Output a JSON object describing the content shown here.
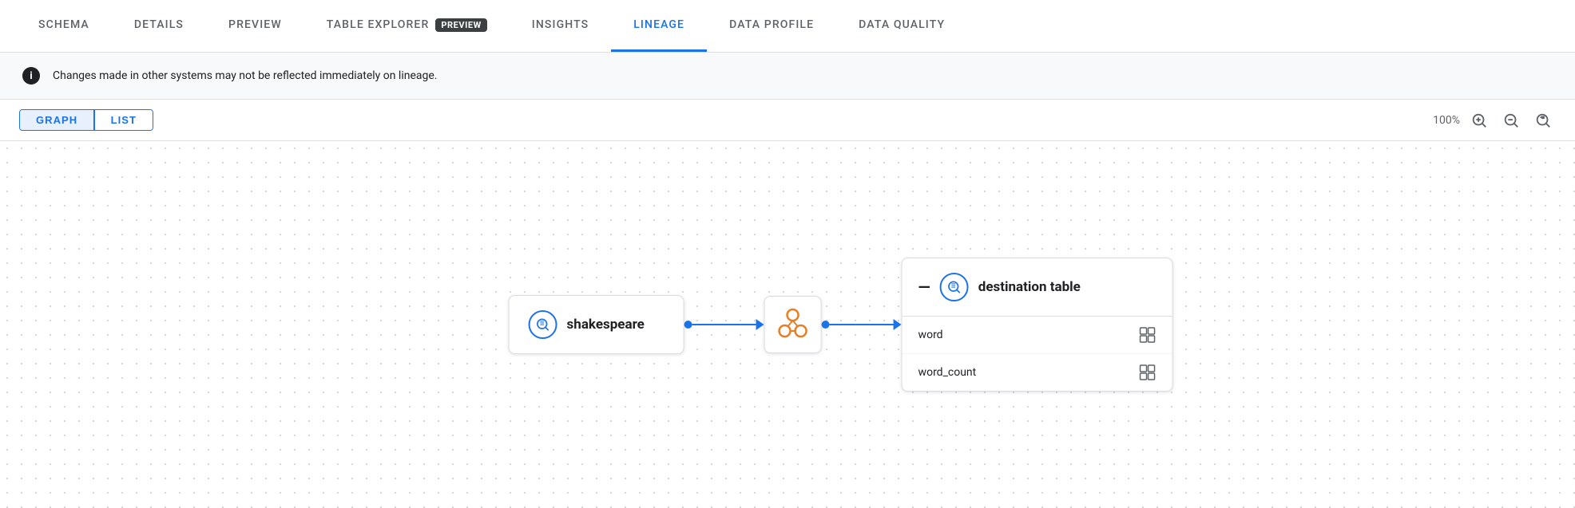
{
  "tabs": [
    {
      "id": "schema",
      "label": "SCHEMA",
      "active": false
    },
    {
      "id": "details",
      "label": "DETAILS",
      "active": false
    },
    {
      "id": "preview",
      "label": "PREVIEW",
      "active": false
    },
    {
      "id": "table-explorer",
      "label": "TABLE EXPLORER",
      "active": false,
      "badge": "PREVIEW"
    },
    {
      "id": "insights",
      "label": "INSIGHTS",
      "active": false
    },
    {
      "id": "lineage",
      "label": "LINEAGE",
      "active": true
    },
    {
      "id": "data-profile",
      "label": "DATA PROFILE",
      "active": false
    },
    {
      "id": "data-quality",
      "label": "DATA QUALITY",
      "active": false
    }
  ],
  "info_banner": {
    "message": "Changes made in other systems may not be reflected immediately on lineage."
  },
  "controls": {
    "graph_label": "GRAPH",
    "list_label": "LIST",
    "active_toggle": "graph",
    "zoom_level": "100%"
  },
  "graph": {
    "source": {
      "label": "shakespeare"
    },
    "destination": {
      "label": "destination table",
      "fields": [
        {
          "name": "word"
        },
        {
          "name": "word_count"
        }
      ]
    }
  },
  "zoom_icons": {
    "zoom_in": "⊕",
    "zoom_out": "⊖",
    "zoom_reset": "↺"
  }
}
